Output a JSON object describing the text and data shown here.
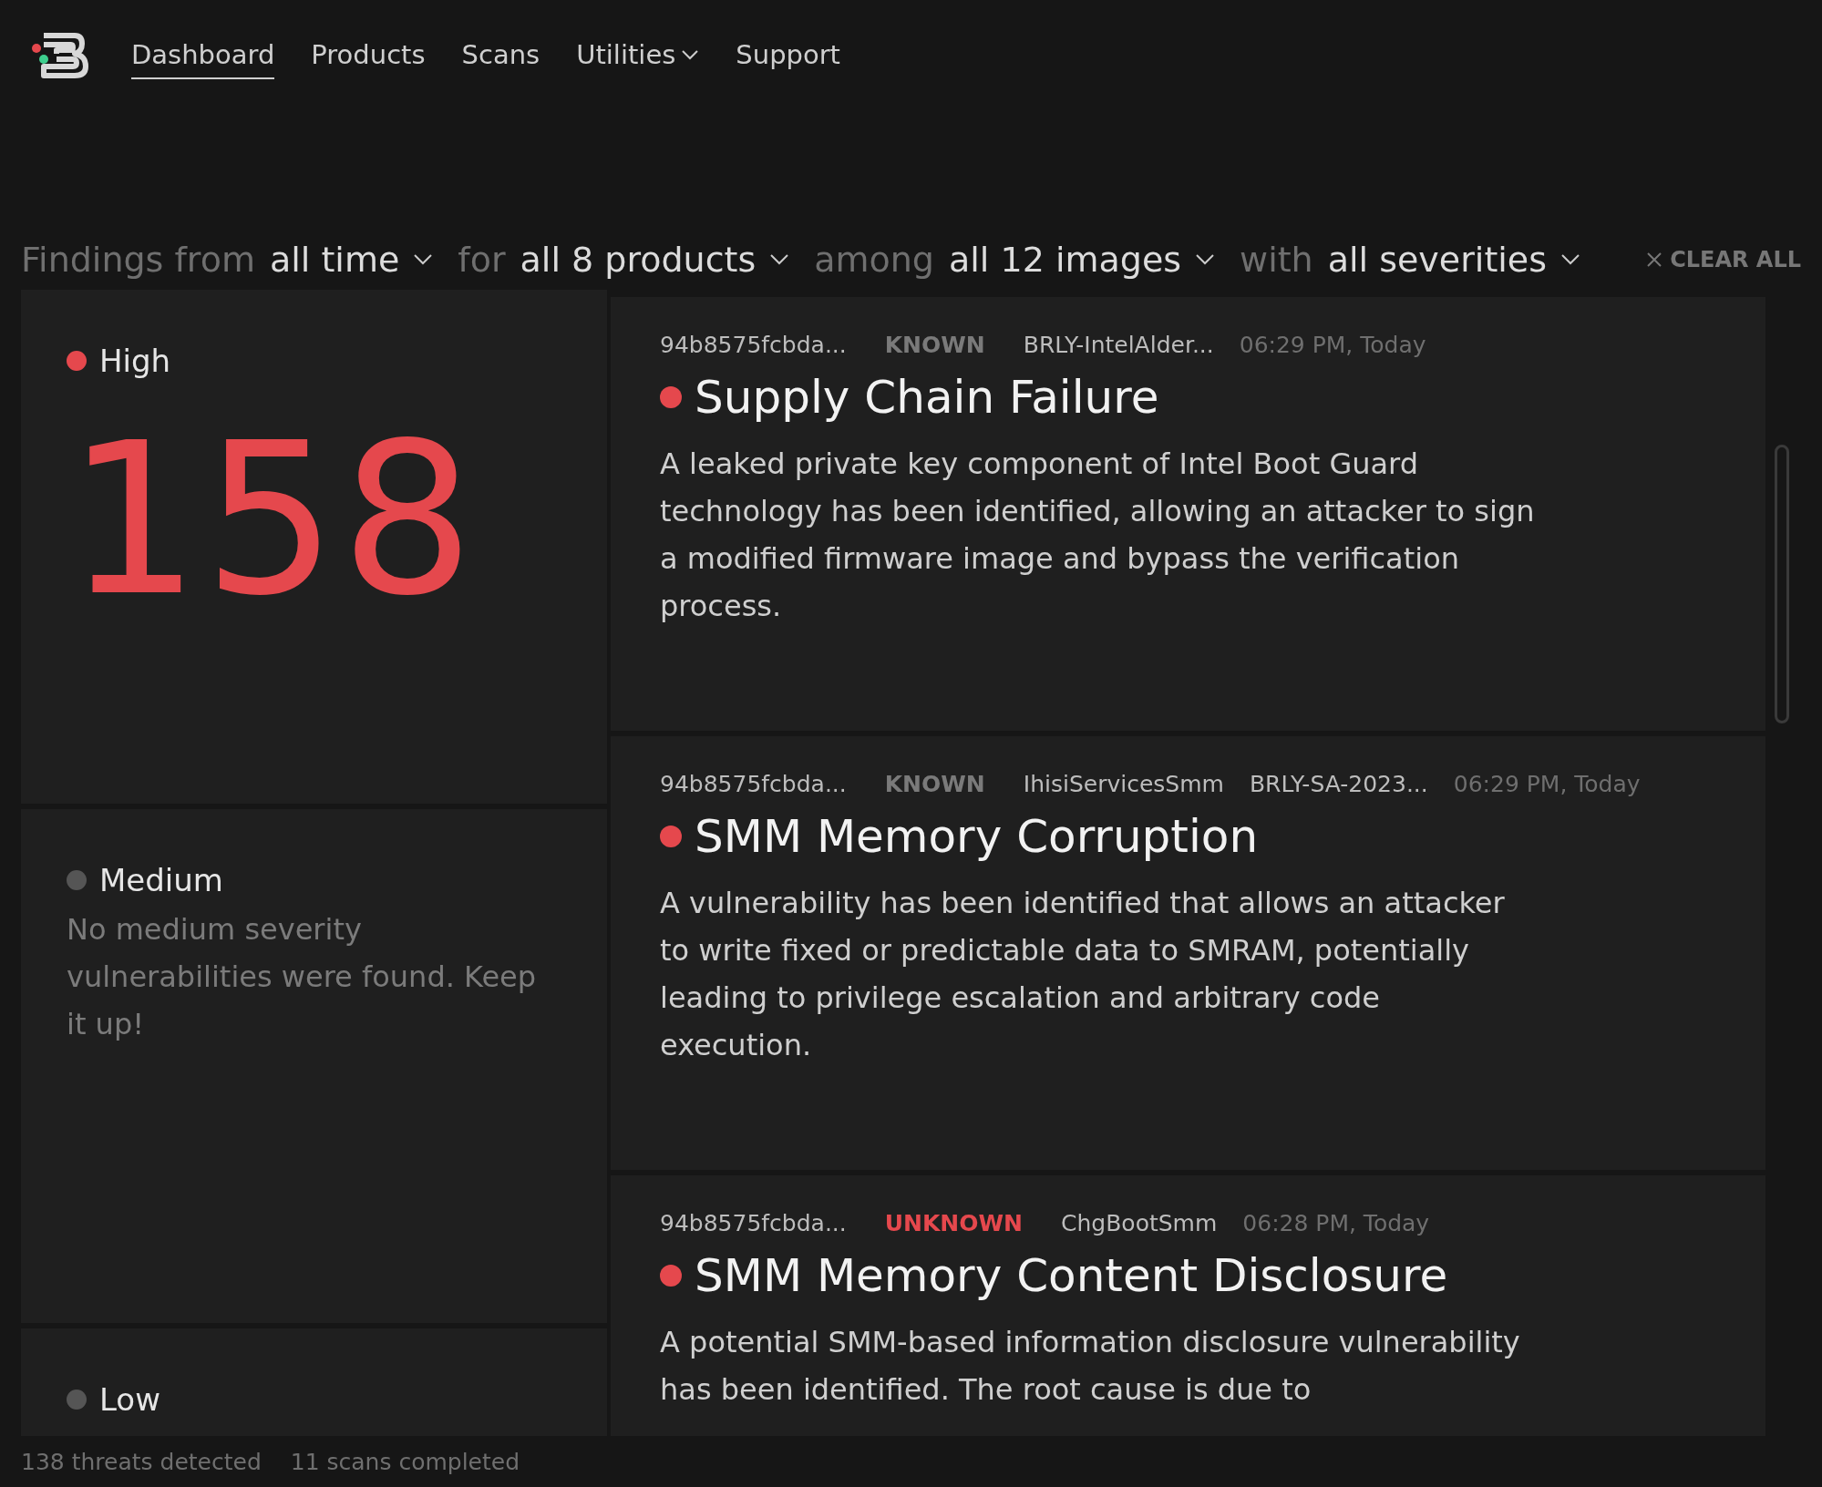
{
  "nav": {
    "items": [
      {
        "label": "Dashboard",
        "selected": true,
        "kind": "link"
      },
      {
        "label": "Products",
        "selected": false,
        "kind": "link"
      },
      {
        "label": "Scans",
        "selected": false,
        "kind": "link"
      },
      {
        "label": "Utilities",
        "selected": false,
        "kind": "dropdown"
      },
      {
        "label": "Support",
        "selected": false,
        "kind": "link"
      }
    ]
  },
  "filters": {
    "parts": [
      {
        "text": "Findings from",
        "kind": "label"
      },
      {
        "text": "all time",
        "kind": "select"
      },
      {
        "text": "for",
        "kind": "label"
      },
      {
        "text": "all 8 products",
        "kind": "select"
      },
      {
        "text": "among",
        "kind": "label"
      },
      {
        "text": "all 12 images",
        "kind": "select"
      },
      {
        "text": "with",
        "kind": "label"
      },
      {
        "text": "all severities",
        "kind": "select"
      }
    ],
    "clear": "CLEAR ALL"
  },
  "severities": [
    {
      "name": "High",
      "color": "#e5484d",
      "count": "158"
    },
    {
      "name": "Medium",
      "color": "#555555",
      "message": "No medium severity vulnerabilities were found. Keep it up!"
    },
    {
      "name": "Low",
      "color": "#555555"
    }
  ],
  "findings": [
    {
      "meta": [
        {
          "text": "94b8575fcbda...",
          "kind": "hash"
        },
        {
          "text": "KNOWN",
          "kind": "status",
          "flagged": false
        },
        {
          "text": "BRLY-IntelAlder...",
          "kind": "text"
        },
        {
          "text": "06:29 PM, Today",
          "kind": "time"
        }
      ],
      "title": "Supply Chain Failure",
      "color": "#e5484d",
      "description": "A leaked private key component of Intel Boot Guard technology has been identified, allowing an attacker to sign a modified firmware image and bypass the verification process."
    },
    {
      "meta": [
        {
          "text": "94b8575fcbda...",
          "kind": "hash"
        },
        {
          "text": "KNOWN",
          "kind": "status",
          "flagged": false
        },
        {
          "text": "IhisiServicesSmm",
          "kind": "text"
        },
        {
          "text": "BRLY-SA-2023...",
          "kind": "text"
        },
        {
          "text": "06:29 PM, Today",
          "kind": "time"
        }
      ],
      "title": "SMM Memory Corruption",
      "color": "#e5484d",
      "description": "A vulnerability has been identified that allows an attacker to write fixed or predictable data to SMRAM, potentially leading to privilege escalation and arbitrary code execution."
    },
    {
      "meta": [
        {
          "text": "94b8575fcbda...",
          "kind": "hash"
        },
        {
          "text": "UNKNOWN",
          "kind": "status",
          "flagged": true
        },
        {
          "text": "ChgBootSmm",
          "kind": "text"
        },
        {
          "text": "06:28 PM, Today",
          "kind": "time"
        }
      ],
      "title": "SMM Memory Content Disclosure",
      "color": "#e5484d",
      "description": "A potential SMM-based information disclosure vulnerability has been identified. The root cause is due to"
    }
  ],
  "status_bar": {
    "items": [
      "138 threats detected",
      "11 scans completed"
    ]
  }
}
